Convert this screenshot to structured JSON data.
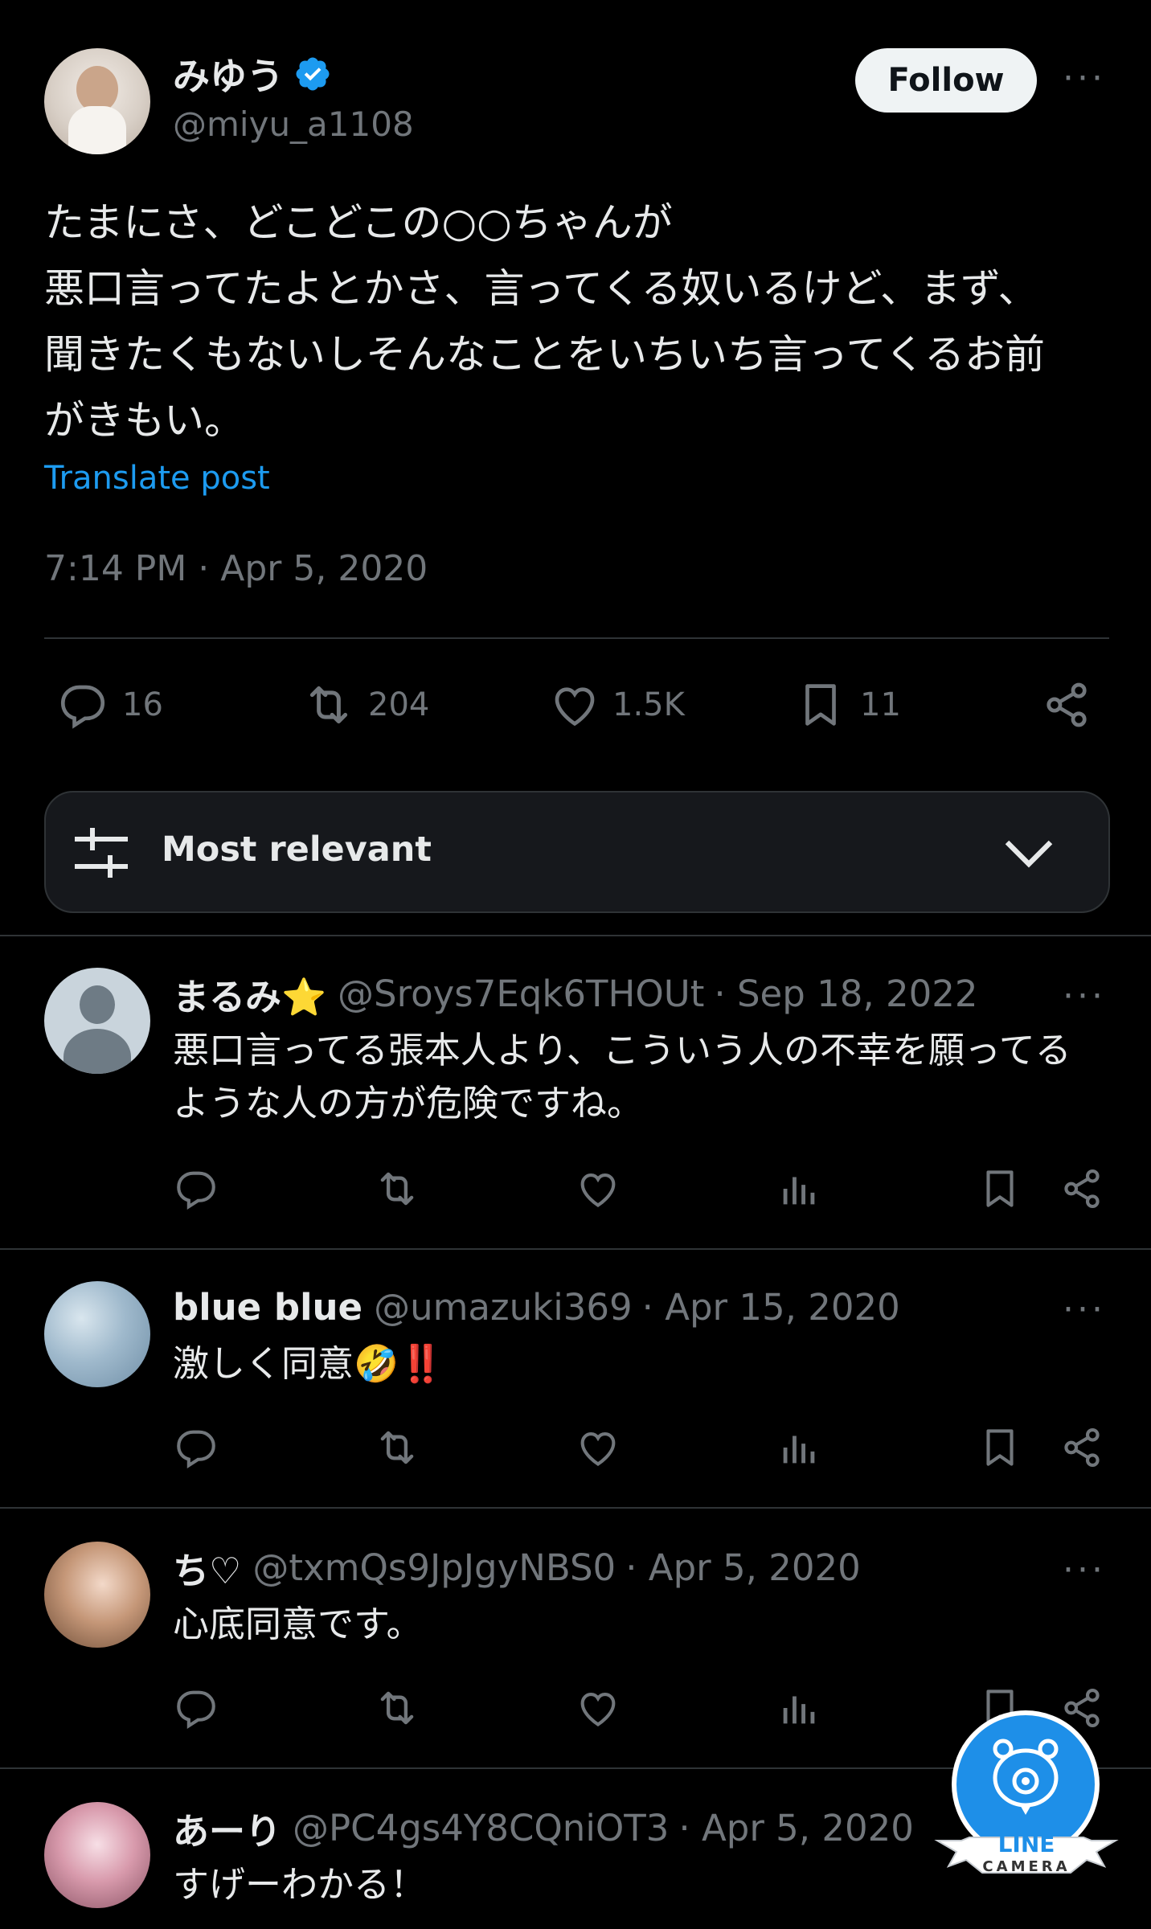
{
  "post": {
    "display_name": "みゆう",
    "handle": "@miyu_a1108",
    "follow_label": "Follow",
    "more_label": "···",
    "text": "たまにさ、どこどこの○○ちゃんが\n悪口言ってたよとかさ、言ってくる奴いるけど、まず、\n聞きたくもないしそんなことをいちいち言ってくるお前\nがきもい。",
    "translate_label": "Translate post",
    "timestamp": "7:14 PM · Apr 5, 2020",
    "stats": {
      "replies": "16",
      "reposts": "204",
      "likes": "1.5K",
      "bookmarks": "11"
    }
  },
  "sort": {
    "label": "Most relevant"
  },
  "replies": [
    {
      "name": "まるみ⭐",
      "handle": "@Sroys7Eqk6THOUt",
      "date": "· Sep 18, 2022",
      "text": "悪口言ってる張本人より、こういう人の不幸を願ってる\nような人の方が危険ですね。"
    },
    {
      "name": "blue blue",
      "handle": "@umazuki369",
      "date": "· Apr 15, 2020",
      "text": "激しく同意🤣‼️"
    },
    {
      "name": "ち♡",
      "handle": "@txmQs9JpJgyNBS0",
      "date": "· Apr 5, 2020",
      "text": "心底同意です。"
    },
    {
      "name": "あーり",
      "handle": "@PC4gs4Y8CQniOT3",
      "date": "· Apr 5, 2020",
      "text": "すげーわかる！"
    }
  ],
  "watermark": {
    "top": "LINE",
    "bottom": "CAMERA"
  },
  "colors": {
    "accent": "#1d9bf0",
    "muted": "#71767b",
    "text": "#e7e9ea",
    "background": "#000000"
  }
}
